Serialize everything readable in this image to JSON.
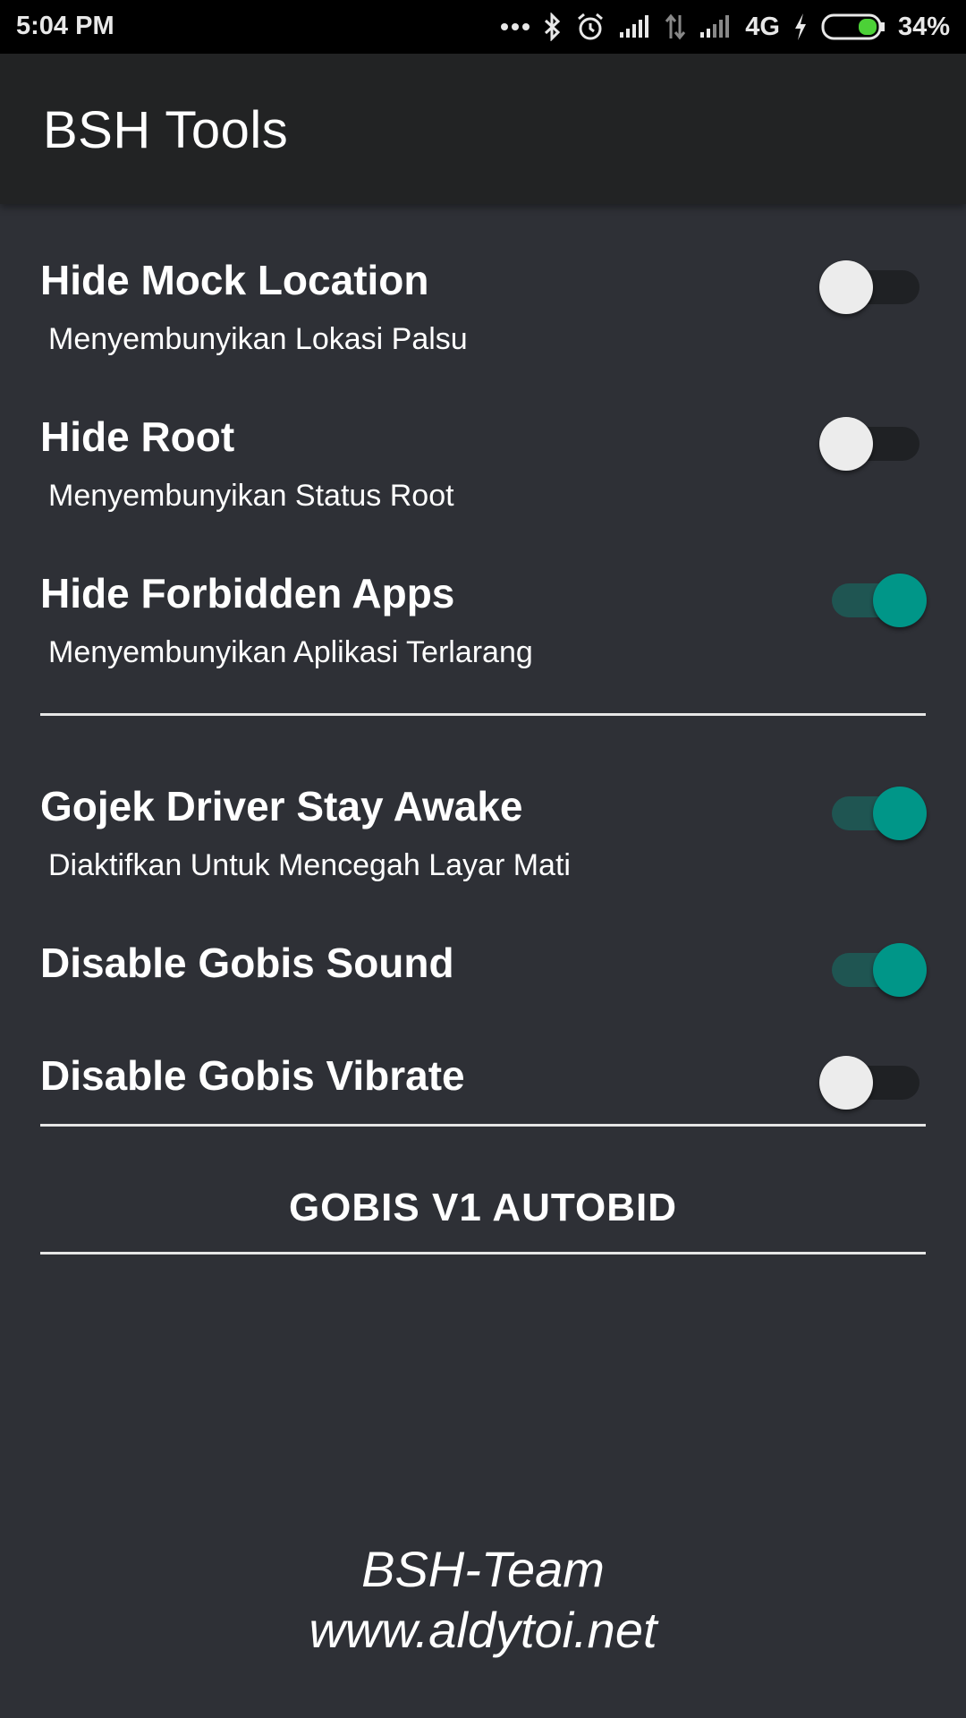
{
  "status_bar": {
    "time": "5:04 PM",
    "network": "4G",
    "battery": "34%",
    "icons": [
      "more-dots-icon",
      "bluetooth-icon",
      "alarm-icon",
      "signal-icon",
      "data-arrows-icon",
      "signal-icon",
      "charging-icon",
      "battery-icon"
    ]
  },
  "app_bar": {
    "title": "BSH Tools"
  },
  "settings": [
    {
      "title": "Hide Mock Location",
      "subtitle": "Menyembunyikan Lokasi Palsu",
      "enabled": false
    },
    {
      "title": "Hide Root",
      "subtitle": "Menyembunyikan Status Root",
      "enabled": false
    },
    {
      "title": "Hide Forbidden Apps",
      "subtitle": "Menyembunyikan Aplikasi Terlarang",
      "enabled": true
    },
    {
      "title": "Gojek Driver Stay Awake",
      "subtitle": "Diaktifkan Untuk Mencegah Layar Mati",
      "enabled": true
    },
    {
      "title": "Disable Gobis Sound",
      "enabled": true
    },
    {
      "title": "Disable Gobis Vibrate",
      "enabled": false
    }
  ],
  "action": {
    "label": "GOBIS V1 AUTOBID"
  },
  "footer": {
    "line1": "BSH-Team",
    "line2": "www.aldytoi.net"
  },
  "colors": {
    "background": "#2e3036",
    "app_bar": "#222324",
    "accent": "#009688",
    "switch_off_thumb": "#ececec"
  }
}
